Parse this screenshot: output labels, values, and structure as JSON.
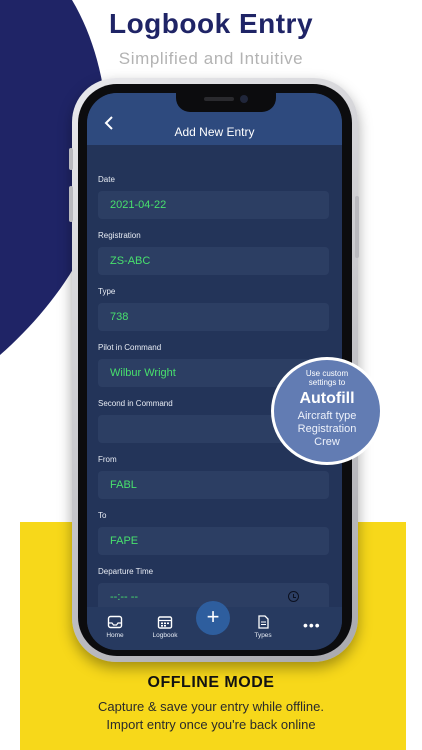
{
  "promo": {
    "headline": "Logbook Entry",
    "subhead": "Simplified and Intuitive",
    "offline_title": "OFFLINE MODE",
    "offline_line1": "Capture & save your entry while offline.",
    "offline_line2": "Import entry once you're back online"
  },
  "colors": {
    "navy": "#1f2466",
    "yellow": "#f7d81a",
    "screen_bg": "#233459",
    "header_bg": "#2e4a7e",
    "value_green": "#48e06d",
    "badge_bg": "#627cb3"
  },
  "header": {
    "title": "Add New Entry",
    "back_icon": "chevron-left-icon"
  },
  "form": {
    "fields": [
      {
        "label": "Date",
        "value": ""
      },
      {
        "label": "Registration",
        "value": ""
      },
      {
        "label": "Type",
        "value": ""
      },
      {
        "label": "Pilot in Command",
        "value": ""
      },
      {
        "label": "Second in Command",
        "value": ""
      },
      {
        "label": "From",
        "value": ""
      },
      {
        "label": "To",
        "value": ""
      },
      {
        "label": "Departure Time",
        "value": ""
      }
    ],
    "values": [
      "2021-04-22",
      "ZS-ABC",
      "738",
      "Wilbur Wright",
      "",
      "FABL",
      "FAPE",
      "--:-- --"
    ]
  },
  "badge": {
    "line1": "Use custom",
    "line2": "settings to",
    "title": "Autofill",
    "item1": "Aircraft type",
    "item2": "Registration",
    "item3": "Crew"
  },
  "tabbar": {
    "home": "Home",
    "logbook": "Logbook",
    "add": "+",
    "types": "Types",
    "more": "•••"
  }
}
